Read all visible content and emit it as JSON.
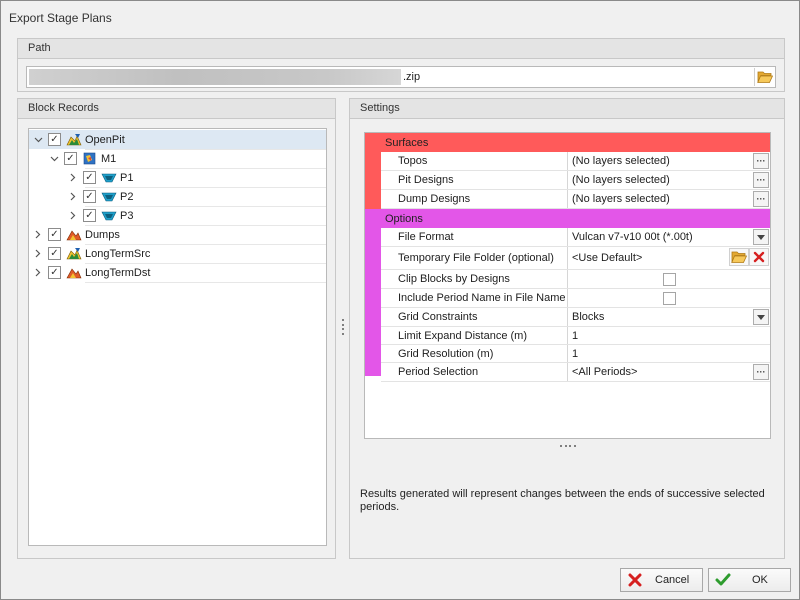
{
  "window": {
    "title": "Export Stage Plans"
  },
  "path": {
    "header": "Path",
    "value_suffix": ".zip",
    "browse_icon": "folder-open-icon"
  },
  "block_records": {
    "header": "Block Records",
    "items": [
      {
        "label": "OpenPit",
        "checked": true,
        "expanded": true,
        "icon": "openpit-icon"
      },
      {
        "label": "M1",
        "checked": true,
        "expanded": true,
        "icon": "model-icon"
      },
      {
        "label": "P1",
        "checked": true,
        "expanded": false,
        "icon": "pit-stage-icon"
      },
      {
        "label": "P2",
        "checked": true,
        "expanded": false,
        "icon": "pit-stage-icon"
      },
      {
        "label": "P3",
        "checked": true,
        "expanded": false,
        "icon": "pit-stage-icon"
      },
      {
        "label": "Dumps",
        "checked": true,
        "expanded": false,
        "icon": "dump-icon"
      },
      {
        "label": "LongTermSrc",
        "checked": true,
        "expanded": false,
        "icon": "openpit-icon"
      },
      {
        "label": "LongTermDst",
        "checked": true,
        "expanded": false,
        "icon": "dump-icon"
      }
    ]
  },
  "settings": {
    "header": "Settings",
    "categories": [
      {
        "label": "Surfaces",
        "color": "#ff5a5a",
        "props": [
          {
            "name": "Topos",
            "value": "(No layers selected)",
            "editor": "ellipsis"
          },
          {
            "name": "Pit Designs",
            "value": "(No layers selected)",
            "editor": "ellipsis"
          },
          {
            "name": "Dump Designs",
            "value": "(No layers selected)",
            "editor": "ellipsis"
          }
        ]
      },
      {
        "label": "Options",
        "color": "#e356e8",
        "props": [
          {
            "name": "File Format",
            "value": "Vulcan v7-v10 00t (*.00t)",
            "editor": "dropdown"
          },
          {
            "name": "Temporary File Folder (optional)",
            "value": "<Use Default>",
            "editor": "folder-clear"
          },
          {
            "name": "Clip Blocks by Designs",
            "value": "",
            "editor": "checkbox",
            "checked": false
          },
          {
            "name": "Include Period Name in File Name",
            "value": "",
            "editor": "checkbox",
            "checked": false
          },
          {
            "name": "Grid Constraints",
            "value": "Blocks",
            "editor": "dropdown"
          },
          {
            "name": "Limit Expand Distance (m)",
            "value": "1",
            "editor": "text"
          },
          {
            "name": "Grid Resolution (m)",
            "value": "1",
            "editor": "text"
          },
          {
            "name": "Period Selection",
            "value": "<All Periods>",
            "editor": "ellipsis"
          }
        ]
      }
    ],
    "note": "Results generated will represent changes between the ends of successive selected periods."
  },
  "buttons": {
    "cancel_label": "Cancel",
    "cancel_icon": "cancel-x-icon",
    "ok_label": "OK",
    "ok_icon": "checkmark-icon"
  }
}
